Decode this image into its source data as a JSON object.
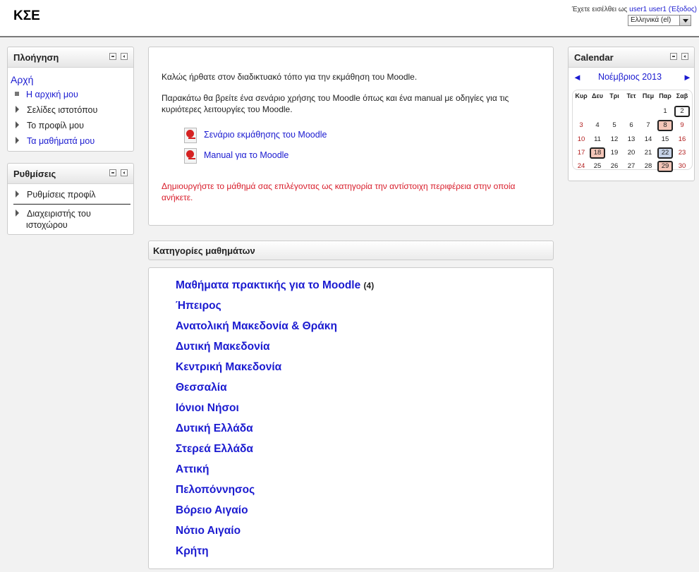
{
  "header": {
    "site_title": "ΚΣΕ",
    "login_prefix": "Έχετε εισέλθει ως",
    "user_link": "user1 user1",
    "logout_link": "(Έξοδος)",
    "language": "Ελληνικά (el)"
  },
  "navigation": {
    "title": "Πλοήγηση",
    "home": "Αρχή",
    "items": [
      {
        "label": "Η αρχική μου"
      },
      {
        "label": "Σελίδες ιστοτόπου"
      },
      {
        "label": "Το προφίλ μου"
      },
      {
        "label": "Τα μαθήματά μου"
      }
    ]
  },
  "settings": {
    "title": "Ρυθμίσεις",
    "items": [
      {
        "label": "Ρυθμίσεις προφίλ"
      },
      {
        "label_line1": "Διαχειριστής του",
        "label_line2": "ιστοχώρου"
      }
    ]
  },
  "main": {
    "welcome": "Καλώς ήρθατε στον διαδικτυακό τόπο για την εκμάθηση του Moodle.",
    "description": "Παρακάτω θα βρείτε ένα σενάριο χρήσης του Moodle όπως και ένα manual με οδηγίες για τις κυριότερες λειτουργίες του Moodle.",
    "links": [
      {
        "label": "Σενάριο εκμάθησης του Moodle"
      },
      {
        "label": "Manual για το Moodle"
      }
    ],
    "note": "Δημιουργήστε το μάθημά σας επιλέγοντας ως κατηγορία την αντίστοιχη περιφέρεια στην οποία ανήκετε."
  },
  "categories": {
    "title": "Κατηγορίες μαθημάτων",
    "items": [
      {
        "label": "Μαθήματα πρακτικής για το Moodle",
        "count": "(4)"
      },
      {
        "label": "Ήπειρος"
      },
      {
        "label": "Ανατολική Μακεδονία & Θράκη"
      },
      {
        "label": "Δυτική Μακεδονία"
      },
      {
        "label": "Κεντρική Μακεδονία"
      },
      {
        "label": "Θεσσαλία"
      },
      {
        "label": "Ιόνιοι Νήσοι"
      },
      {
        "label": "Δυτική Ελλάδα"
      },
      {
        "label": "Στερεά Ελλάδα"
      },
      {
        "label": "Αττική"
      },
      {
        "label": "Πελοπόννησος"
      },
      {
        "label": "Βόρειο Αιγαίο"
      },
      {
        "label": "Νότιο Αιγαίο"
      },
      {
        "label": "Κρήτη"
      }
    ]
  },
  "calendar": {
    "title": "Calendar",
    "prev": "◄",
    "next": "►",
    "month": "Νοέμβριος 2013",
    "weekdays": [
      "Κυρ",
      "Δευ",
      "Τρι",
      "Τετ",
      "Πεμ",
      "Παρ",
      "Σαβ"
    ],
    "weeks": [
      [
        "",
        "",
        "",
        "",
        "",
        "1",
        "2"
      ],
      [
        "3",
        "4",
        "5",
        "6",
        "7",
        "8",
        "9"
      ],
      [
        "10",
        "11",
        "12",
        "13",
        "14",
        "15",
        "16"
      ],
      [
        "17",
        "18",
        "19",
        "20",
        "21",
        "22",
        "23"
      ],
      [
        "24",
        "25",
        "26",
        "27",
        "28",
        "29",
        "30"
      ]
    ],
    "event_days": [
      "8",
      "18",
      "29"
    ],
    "today": "2",
    "today_event": "22",
    "colors": {
      "event": "#f4c6b8",
      "weekend": "#b22020",
      "link": "#1a1ad0"
    }
  }
}
